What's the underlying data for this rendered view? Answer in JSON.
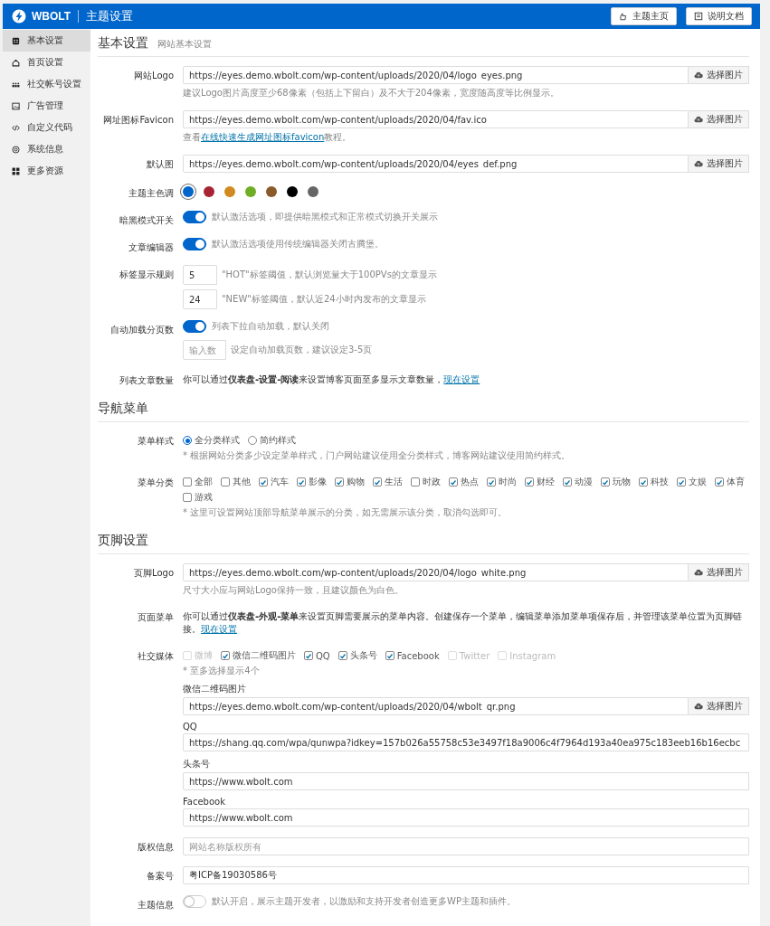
{
  "header": {
    "logo_text": "WBOLT",
    "title": "主题设置",
    "buttons": [
      {
        "label": "主题主页",
        "kind": "home"
      },
      {
        "label": "说明文档",
        "kind": "doc"
      }
    ]
  },
  "sidebar": {
    "items": [
      {
        "label": "基本设置",
        "kind": "basic",
        "selected": true
      },
      {
        "label": "首页设置",
        "kind": "home",
        "selected": false
      },
      {
        "label": "社交帐号设置",
        "kind": "social",
        "selected": false
      },
      {
        "label": "广告管理",
        "kind": "ad",
        "selected": false
      },
      {
        "label": "自定义代码",
        "kind": "code",
        "selected": false
      },
      {
        "label": "系统信息",
        "kind": "info",
        "selected": false
      },
      {
        "label": "更多资源",
        "kind": "more",
        "selected": false
      }
    ]
  },
  "sections": [
    {
      "title": "基本设置",
      "subtitle": "网站基本设置",
      "rows": [
        {
          "kind": "upload",
          "label": "网站Logo",
          "value": "https://eyes.demo.wbolt.com/wp-content/uploads/2020/04/logo_eyes.png",
          "button": "选择图片",
          "hint_parts": [
            {
              "kind": "text",
              "text": "建议Logo图片高度至少68像素（包括上下留白）及不大于204像素，宽度随高度等比例显示。"
            }
          ]
        },
        {
          "kind": "upload",
          "label": "网址图标Favicon",
          "value": "https://eyes.demo.wbolt.com/wp-content/uploads/2020/04/fav.ico",
          "button": "选择图片",
          "hint_parts": [
            {
              "kind": "text",
              "text": "查看"
            },
            {
              "kind": "link",
              "text": "在线快速生成网址图标favicon"
            },
            {
              "kind": "text",
              "text": "教程。"
            }
          ]
        },
        {
          "kind": "upload",
          "label": "默认图",
          "value": "https://eyes.demo.wbolt.com/wp-content/uploads/2020/04/eyes_def.png",
          "button": "选择图片"
        },
        {
          "kind": "colors",
          "label": "主题主色调",
          "swatches": [
            {
              "color": "#0066cc",
              "selected": true
            },
            {
              "color": "#a62434",
              "selected": false
            },
            {
              "color": "#d08a1f",
              "selected": false
            },
            {
              "color": "#6fad25",
              "selected": false
            },
            {
              "color": "#8b5a2b",
              "selected": false
            },
            {
              "color": "#000000",
              "selected": false
            },
            {
              "color": "#666666",
              "selected": false
            }
          ]
        },
        {
          "kind": "toggle",
          "label": "暗黑模式开关",
          "on": true,
          "note": "默认激活选项，即提供暗黑模式和正常模式切换开关展示"
        },
        {
          "kind": "toggle",
          "label": "文章编辑器",
          "on": true,
          "note": "默认激活选项使用传统编辑器关闭古腾堡。"
        },
        {
          "kind": "numbers",
          "label": "标签显示规则",
          "inputs": [
            {
              "value": "5",
              "note": "\"HOT\"标签阈值，默认浏览量大于100PVs的文章显示"
            },
            {
              "value": "24",
              "note": "\"NEW\"标签阈值，默认近24小时内发布的文章显示"
            }
          ]
        },
        {
          "kind": "toggle",
          "label": "自动加载分页数",
          "on": true,
          "note": "列表下拉自动加载，默认关闭",
          "input": {
            "placeholder": "输入数",
            "note": "设定自动加载页数，建议设定3-5页"
          }
        },
        {
          "kind": "text",
          "label": "列表文章数量",
          "text": "你可以通过**仪表盘-设置-阅读**来设置博客页面至多显示文章数量，",
          "link": "现在设置"
        }
      ]
    },
    {
      "title": "导航菜单",
      "rows": [
        {
          "kind": "radio",
          "label": "菜单样式",
          "options": [
            {
              "label": "全分类样式",
              "selected": true
            },
            {
              "label": "简约样式",
              "selected": false
            }
          ],
          "note": "* 根据网站分类多少设定菜单样式，门户网站建议使用全分类样式，博客网站建议使用简约样式。"
        },
        {
          "kind": "checks",
          "label": "菜单分类",
          "options": [
            {
              "label": "全部",
              "checked": false
            },
            {
              "label": "其他",
              "checked": false
            },
            {
              "label": "汽车",
              "checked": true
            },
            {
              "label": "影像",
              "checked": true
            },
            {
              "label": "购物",
              "checked": true
            },
            {
              "label": "生活",
              "checked": true
            },
            {
              "label": "时政",
              "checked": false
            },
            {
              "label": "热点",
              "checked": true
            },
            {
              "label": "时尚",
              "checked": true
            },
            {
              "label": "财经",
              "checked": true
            },
            {
              "label": "动漫",
              "checked": true
            },
            {
              "label": "玩物",
              "checked": true
            },
            {
              "label": "科技",
              "checked": true
            },
            {
              "label": "文娱",
              "checked": true
            },
            {
              "label": "体育",
              "checked": true
            },
            {
              "label": "游戏",
              "checked": false
            }
          ],
          "note": "* 这里可设置网站顶部导航菜单展示的分类，如无需展示该分类，取消勾选即可。"
        }
      ]
    },
    {
      "title": "页脚设置",
      "rows": [
        {
          "kind": "upload",
          "label": "页脚Logo",
          "value": "https://eyes.demo.wbolt.com/wp-content/uploads/2020/04/logo_white.png",
          "button": "选择图片",
          "hint_parts": [
            {
              "kind": "text",
              "text": "尺寸大小应与网站Logo保持一致，且建议颜色为白色。"
            }
          ]
        },
        {
          "kind": "text",
          "label": "页面菜单",
          "text": "你可以通过**仪表盘-外观-菜单**来设置页脚需要展示的菜单内容。创建保存一个菜单，编辑菜单添加菜单项保存后，并管理该菜单位置为页脚链接。",
          "link": "现在设置"
        },
        {
          "kind": "checks",
          "label": "社交媒体",
          "options": [
            {
              "label": "微博",
              "checked": false,
              "disabled": true
            },
            {
              "label": "微信二维码图片",
              "checked": true,
              "disabled": false
            },
            {
              "label": "QQ",
              "checked": true,
              "disabled": false
            },
            {
              "label": "头条号",
              "checked": true,
              "disabled": false
            },
            {
              "label": "Facebook",
              "checked": true,
              "disabled": false
            },
            {
              "label": "Twitter",
              "checked": false,
              "disabled": true
            },
            {
              "label": "Instagram",
              "checked": false,
              "disabled": true
            }
          ],
          "note": "* 至多选择显示4个",
          "fields": [
            {
              "label": "微信二维码图片",
              "value": "https://eyes.demo.wbolt.com/wp-content/uploads/2020/04/wbolt_qr.png",
              "button": "选择图片"
            },
            {
              "label": "QQ",
              "value": "https://shang.qq.com/wpa/qunwpa?idkey=157b026a55758c53e3497f18a9006c4f7964d193a40ea975c183eeb16b16ecbc"
            },
            {
              "label": "头条号",
              "value": "https://www.wbolt.com"
            },
            {
              "label": "Facebook",
              "value": "https://www.wbolt.com"
            }
          ]
        },
        {
          "kind": "input",
          "label": "版权信息",
          "placeholder": "网站名称版权所有"
        },
        {
          "kind": "input",
          "label": "备案号",
          "value": "粤ICP备19030586号"
        },
        {
          "kind": "toggle",
          "label": "主题信息",
          "on": false,
          "note": "默认开启，展示主题开发者，以激励和支持开发者创造更多WP主题和插件。"
        }
      ]
    }
  ]
}
